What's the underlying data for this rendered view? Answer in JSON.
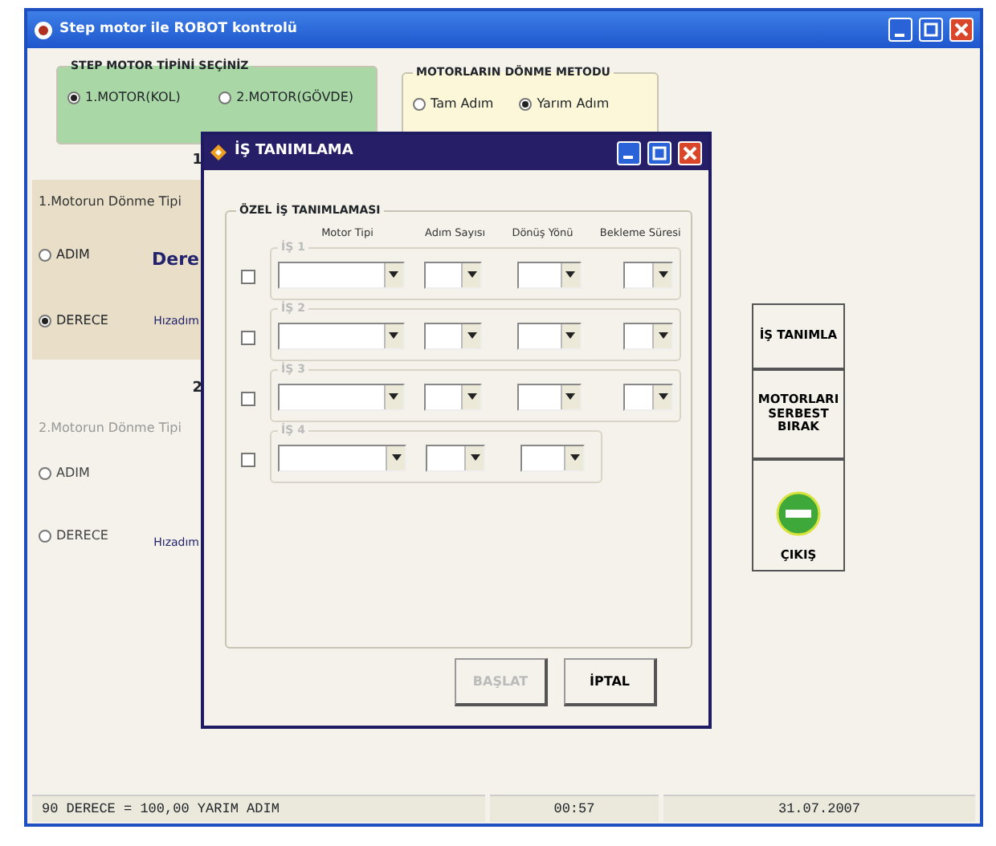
{
  "window": {
    "title": "Step motor ile  ROBOT kontrolü"
  },
  "motor_type": {
    "title": "STEP MOTOR TİPİNİ SEÇİNİZ",
    "options": [
      {
        "label": "1.MOTOR(KOL)",
        "selected": true
      },
      {
        "label": "2.MOTOR(GÖVDE)",
        "selected": false
      }
    ]
  },
  "rotation_method": {
    "title": "MOTORLARIN DÖNME METODU",
    "options": [
      {
        "label": "Tam Adım",
        "selected": false
      },
      {
        "label": "Yarım Adım",
        "selected": true
      }
    ]
  },
  "motor_panels": [
    {
      "heading": "1",
      "title": "1.Motorun Dönme Tipi",
      "active": true,
      "options": [
        {
          "label": "ADIM",
          "selected": false
        },
        {
          "label": "DERECE",
          "selected": true
        }
      ],
      "value_label": "Dere",
      "speed_label": "Hızadım"
    },
    {
      "heading": "2",
      "title": "2.Motorun Dönme Tipi",
      "active": false,
      "options": [
        {
          "label": "ADIM",
          "selected": false
        },
        {
          "label": "DERECE",
          "selected": false
        }
      ],
      "speed_label": "Hızadım"
    }
  ],
  "side_buttons": [
    {
      "label": "İŞ TANIMLA",
      "kind": "text"
    },
    {
      "label": "MOTORLARI SERBEST BIRAK",
      "kind": "text"
    },
    {
      "label": "ÇIKIŞ",
      "kind": "exit"
    }
  ],
  "status_bar": [
    "90 DERECE = 100,00 YARIM ADIM",
    "00:57",
    "31.07.2007"
  ],
  "dialog": {
    "title": "İŞ TANIMLAMA",
    "group_title": "ÖZEL İŞ TANIMLAMASI",
    "columns": [
      "Motor Tipi",
      "Adım Sayısı",
      "Dönüş Yönü",
      "Bekleme Süresi"
    ],
    "jobs": [
      {
        "label": "İŞ 1",
        "checked": false,
        "fields": [
          {
            "kind": "motor"
          },
          {
            "kind": "steps"
          },
          {
            "kind": "direction"
          },
          {
            "kind": "wait"
          }
        ]
      },
      {
        "label": "İŞ 2",
        "checked": false,
        "fields": [
          {
            "kind": "motor"
          },
          {
            "kind": "steps"
          },
          {
            "kind": "direction"
          },
          {
            "kind": "wait"
          }
        ]
      },
      {
        "label": "İŞ 3",
        "checked": false,
        "fields": [
          {
            "kind": "motor"
          },
          {
            "kind": "steps"
          },
          {
            "kind": "direction"
          },
          {
            "kind": "wait"
          }
        ]
      },
      {
        "label": "İŞ 4",
        "checked": false,
        "fields": [
          {
            "kind": "motor"
          },
          {
            "kind": "steps"
          },
          {
            "kind": "direction"
          }
        ]
      }
    ],
    "buttons": [
      {
        "label": "BAŞLAT",
        "disabled": true
      },
      {
        "label": "İPTAL",
        "disabled": false
      }
    ]
  }
}
